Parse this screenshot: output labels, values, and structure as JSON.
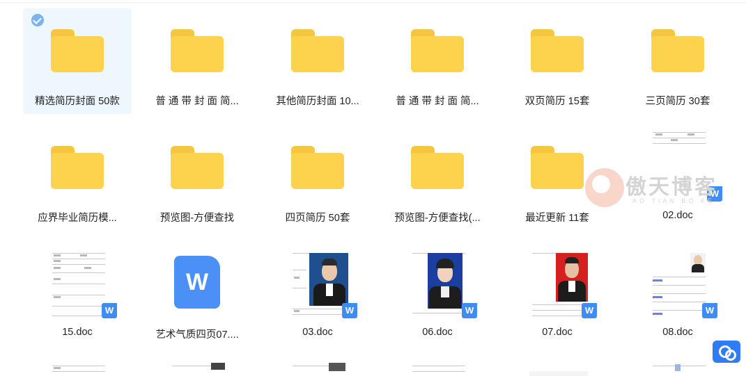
{
  "items": [
    {
      "type": "folder",
      "label": "精选简历封面 50款",
      "selected": true
    },
    {
      "type": "folder",
      "label": "普 通 带 封 面 简..."
    },
    {
      "type": "folder",
      "label": "其他简历封面 10..."
    },
    {
      "type": "folder",
      "label": "普 通 带 封 面 简..."
    },
    {
      "type": "folder",
      "label": "双页简历 15套"
    },
    {
      "type": "folder",
      "label": "三页简历 30套"
    },
    {
      "type": "folder",
      "label": "应界毕业简历模..."
    },
    {
      "type": "folder",
      "label": "预览图-方便查找"
    },
    {
      "type": "folder",
      "label": "四页简历 50套"
    },
    {
      "type": "folder",
      "label": "预览图-方便查找(..."
    },
    {
      "type": "folder",
      "label": "最近更新 11套"
    },
    {
      "type": "doc",
      "label": "02.doc"
    },
    {
      "type": "doc",
      "label": "15.doc"
    },
    {
      "type": "doc-icon",
      "label": "艺术气质四页07...."
    },
    {
      "type": "doc",
      "label": "03.doc"
    },
    {
      "type": "doc",
      "label": "06.doc"
    },
    {
      "type": "doc",
      "label": "07.doc"
    },
    {
      "type": "doc",
      "label": "08.doc"
    }
  ],
  "badge_letter": "W",
  "watermark": {
    "title": "傲天博客",
    "subtitle": "AO TIAN BO KE"
  },
  "colors": {
    "folder": "#fdd24d",
    "accent": "#3f8cf5",
    "selected_bg": "#eef6fe"
  }
}
